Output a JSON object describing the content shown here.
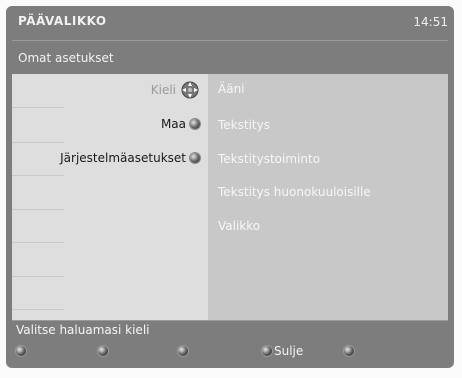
{
  "header": {
    "title": "PÄÄVALIKKO",
    "time": "14:51"
  },
  "subtitle": "Omat asetukset",
  "left_menu": [
    {
      "label": "Kieli",
      "active": true
    },
    {
      "label": "Maa"
    },
    {
      "label": "Järjestelmäasetukset"
    }
  ],
  "right_menu": [
    {
      "label": "Ääni"
    },
    {
      "label": "Tekstitys"
    },
    {
      "label": "Tekstitystoiminto"
    },
    {
      "label": "Tekstitys huonokuuloisille"
    },
    {
      "label": "Valikko"
    }
  ],
  "status": "Valitse haluamasi kieli",
  "footer": {
    "close_label": "Sulje"
  },
  "icons": {
    "select": "dpad-icon",
    "bullet": "round-button-icon"
  }
}
